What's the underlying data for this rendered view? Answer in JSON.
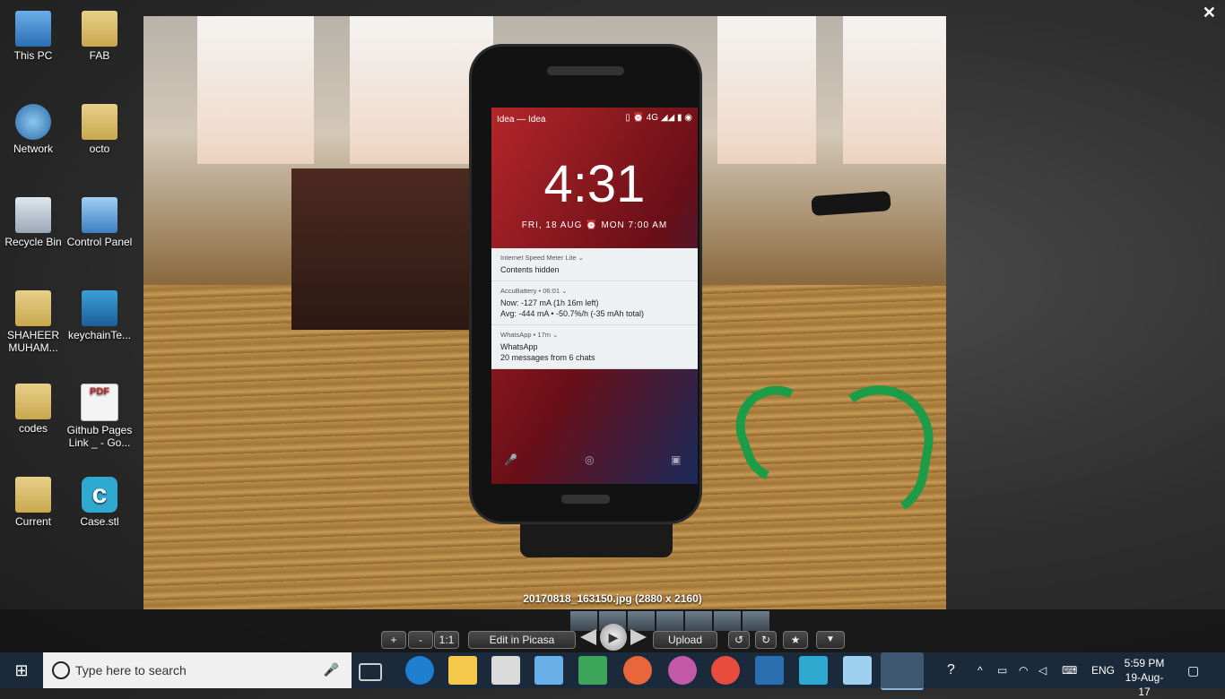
{
  "desktop_icons": [
    {
      "label": "This PC",
      "icon": "this-pc-icon",
      "kind": "pc",
      "left": 0,
      "top": 0
    },
    {
      "label": "FAB",
      "icon": "folder-icon",
      "kind": "folder"
    },
    {
      "label": "Network",
      "icon": "network-icon",
      "kind": "net"
    },
    {
      "label": "octo",
      "icon": "folder-icon",
      "kind": "folder"
    },
    {
      "label": "Recycle Bin",
      "icon": "recycle-bin-icon",
      "kind": "bin"
    },
    {
      "label": "Control Panel",
      "icon": "control-panel-icon",
      "kind": "cp"
    },
    {
      "label": "SHAHEER MUHAM...",
      "icon": "folder-icon",
      "kind": "folder"
    },
    {
      "label": "keychainTe...",
      "icon": "file-icon",
      "kind": "kc"
    },
    {
      "label": "codes",
      "icon": "folder-icon",
      "kind": "folder"
    },
    {
      "label": "Github Pages Link _ - Go...",
      "icon": "pdf-icon",
      "kind": "pdf"
    },
    {
      "label": "Current",
      "icon": "folder-icon",
      "kind": "folder"
    },
    {
      "label": "Case.stl",
      "icon": "cura-icon",
      "kind": "cura"
    }
  ],
  "viewer": {
    "caption": "20170818_163150.jpg (2880 x 2160)",
    "close": "✕",
    "zoom_in": "+",
    "zoom_out": "-",
    "actual_size": "1:1",
    "edit": "Edit in Picasa",
    "upload": "Upload",
    "rotate_left": "↺",
    "rotate_right": "↻",
    "star": "★",
    "more": "▼",
    "play": "▶"
  },
  "phone_screen": {
    "carrier": "Idea — Idea",
    "status_icons": "▯ ⏰ 4G ◢◢ ▮ ◉",
    "time": "4:31",
    "date_line": "FRI, 18 AUG  ⏰ MON 7:00 AM",
    "notifications": [
      {
        "app": "Internet Speed Meter Lite ⌄",
        "line1": "Contents hidden",
        "line2": ""
      },
      {
        "app": "AccuBattery • 06:01 ⌄",
        "line1": "Now: -127 mA (1h 16m left)",
        "line2": "Avg: -444 mA • -50.7%/h (-35 mAh total)"
      },
      {
        "app": "WhatsApp • 17m ⌄",
        "line1": "WhatsApp",
        "line2": "20 messages from 6 chats"
      }
    ]
  },
  "taskbar": {
    "start_glyph": "⊞",
    "search_placeholder": "Type here to search",
    "time": "5:59 PM",
    "date": "19-Aug-17",
    "language": "ENG"
  },
  "colors": {
    "taskbar": "#1b2a3a",
    "search_bg": "#f0f0f0",
    "viewer_bar": "#141414"
  }
}
